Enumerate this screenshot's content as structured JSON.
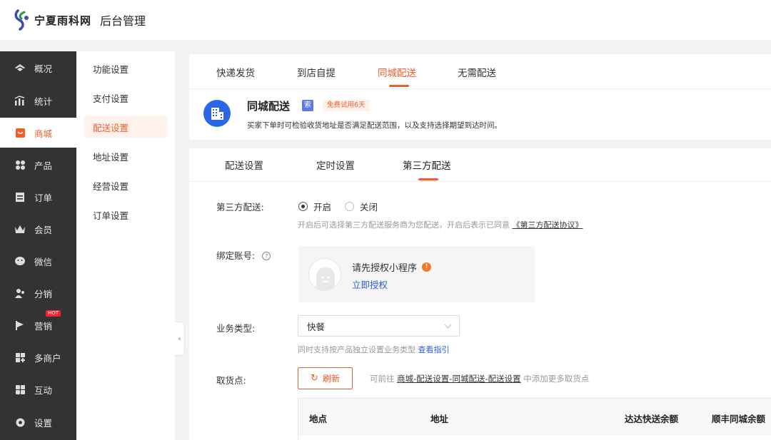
{
  "header": {
    "logo_text": "宁夏雨科网",
    "title": "后台管理"
  },
  "sidebar": {
    "items": [
      {
        "label": "概况",
        "icon": "eye-icon"
      },
      {
        "label": "统计",
        "icon": "chart-icon"
      },
      {
        "label": "商城",
        "icon": "shop-icon",
        "active": true
      },
      {
        "label": "产品",
        "icon": "grid-icon"
      },
      {
        "label": "订单",
        "icon": "order-icon"
      },
      {
        "label": "会员",
        "icon": "crown-icon"
      },
      {
        "label": "微信",
        "icon": "wechat-icon"
      },
      {
        "label": "分销",
        "icon": "users-icon"
      },
      {
        "label": "营销",
        "icon": "flag-icon",
        "badge": "HOT"
      },
      {
        "label": "多商户",
        "icon": "store-icon"
      },
      {
        "label": "互动",
        "icon": "chat-icon"
      },
      {
        "label": "设置",
        "icon": "gear-icon"
      }
    ]
  },
  "subnav": {
    "items": [
      {
        "label": "功能设置"
      },
      {
        "label": "支付设置"
      },
      {
        "label": "配送设置",
        "active": true
      },
      {
        "label": "地址设置"
      },
      {
        "label": "经营设置"
      },
      {
        "label": "订单设置"
      }
    ]
  },
  "delivery_tabs": [
    {
      "label": "快递发货"
    },
    {
      "label": "到店自提"
    },
    {
      "label": "同城配送",
      "active": true
    },
    {
      "label": "无需配送"
    }
  ],
  "service": {
    "title": "同城配送",
    "icon_badge": "索",
    "trial_badge": "免费试用6天",
    "description": "买家下单时可检验收货地址是否满足配送范围，以及支持选择期望到达时间。"
  },
  "sub_tabs": [
    {
      "label": "配送设置"
    },
    {
      "label": "定时设置"
    },
    {
      "label": "第三方配送",
      "active": true
    }
  ],
  "form": {
    "third_party": {
      "label": "第三方配送:",
      "on_label": "开启",
      "off_label": "关闭",
      "selected": "开启",
      "hint_prefix": "开启后可选择第三方配送服务商为您配送，开启后表示已同意",
      "hint_link": "《第三方配送协议》"
    },
    "bind_account": {
      "label": "绑定账号:",
      "help_icon": "?",
      "auth_text": "请先授权小程序",
      "warn": "!",
      "auth_link": "立即授权"
    },
    "business_type": {
      "label": "业务类型:",
      "value": "快餐",
      "hint_prefix": "同时支持按产品独立设置业务类型",
      "hint_link": "查看指引"
    },
    "pickup": {
      "label": "取货点:",
      "refresh_label": "刷新",
      "hint_prefix": "可前往",
      "hint_link": "商城-配送设置-同城配送-配送设置",
      "hint_suffix": "中添加更多取货点"
    }
  },
  "table": {
    "columns": [
      "地点",
      "地址",
      "达达快送余额",
      "顺丰同城余额"
    ]
  },
  "colors": {
    "accent": "#f25c2a",
    "sidebar_bg": "#333333",
    "link_blue": "#2d5bd3",
    "service_icon_bg": "#2c66e8"
  }
}
